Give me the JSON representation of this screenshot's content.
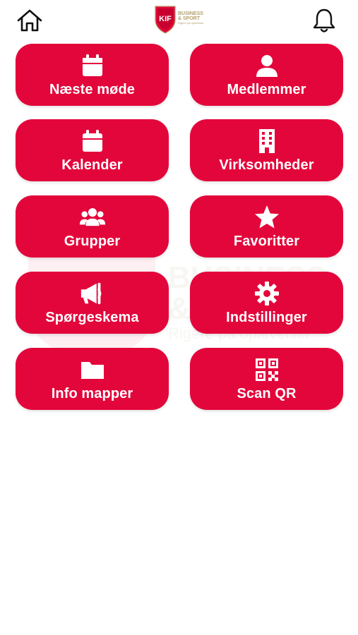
{
  "header": {
    "home_icon": "home-icon",
    "bell_icon": "bell-icon",
    "logo": {
      "shield_letters": "KIF",
      "line1": "BUSINESS",
      "line2": "& SPORT",
      "tagline": "Rigere på oplevelser"
    }
  },
  "watermark": {
    "line1": "BUSINESS",
    "line2": "& SPORT",
    "tagline": "Rigere på oplevelser"
  },
  "colors": {
    "accent": "#e3063b",
    "logo_gold": "#b3a06a"
  },
  "tiles": [
    {
      "label": "Næste møde",
      "icon": "calendar-icon"
    },
    {
      "label": "Medlemmer",
      "icon": "user-icon"
    },
    {
      "label": "Kalender",
      "icon": "calendar-icon"
    },
    {
      "label": "Virksomheder",
      "icon": "building-icon"
    },
    {
      "label": "Grupper",
      "icon": "users-icon"
    },
    {
      "label": "Favoritter",
      "icon": "star-icon"
    },
    {
      "label": "Spørgeskema",
      "icon": "megaphone-icon"
    },
    {
      "label": "Indstillinger",
      "icon": "gear-icon"
    },
    {
      "label": "Info mapper",
      "icon": "folder-icon"
    },
    {
      "label": "Scan QR",
      "icon": "qr-code-icon"
    }
  ]
}
